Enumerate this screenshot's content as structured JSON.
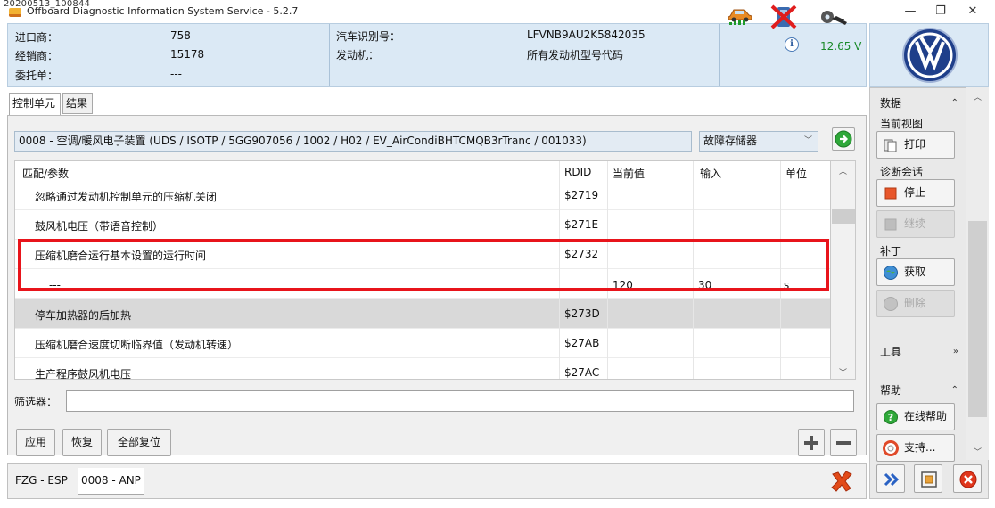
{
  "titlebar": {
    "stamp": "20200513_100844",
    "title": "Offboard Diagnostic Information System Service - 5.2.7",
    "minimize": "—",
    "restore": "❐",
    "close": "✕"
  },
  "header": {
    "importer_label": "进口商：",
    "importer_value": "758",
    "dealer_label": "经销商：",
    "dealer_value": "15178",
    "order_label": "委托单：",
    "order_value": "---",
    "vin_label": "汽车识别号：",
    "vin_value": "LFVNB9AU2K5842035",
    "engine_label": "发动机：",
    "engine_value": "所有发动机型号代码",
    "voltage": "12.65 V"
  },
  "tabs": [
    {
      "label": "控制单元"
    },
    {
      "label": "结果"
    }
  ],
  "control_unit": {
    "description": "0008 - 空调/暖风电子装置 (UDS / ISOTP / 5GG907056 / 1002 / H02 / EV_AirCondiBHTCMQB3rTranc / 001033)",
    "mode": "故障存储器"
  },
  "table": {
    "columns": {
      "param": "匹配/参数",
      "rdid": "RDID",
      "current": "当前值",
      "input": "输入",
      "unit": "单位"
    },
    "rows": [
      {
        "param": "忽略通过发动机控制单元的压缩机关闭",
        "rdid": "$2719",
        "current": "",
        "input": "",
        "unit": ""
      },
      {
        "param": "鼓风机电压（带语音控制）",
        "rdid": "$271E",
        "current": "",
        "input": "",
        "unit": ""
      },
      {
        "param": "压缩机磨合运行基本设置的运行时间",
        "rdid": "$2732",
        "current": "",
        "input": "",
        "unit": ""
      },
      {
        "param": "---",
        "rdid": "",
        "current": "120",
        "input": "30",
        "unit": "s"
      },
      {
        "param": "停车加热器的后加热",
        "rdid": "$273D",
        "current": "",
        "input": "",
        "unit": ""
      },
      {
        "param": "压缩机磨合速度切断临界值（发动机转速）",
        "rdid": "$27AB",
        "current": "",
        "input": "",
        "unit": ""
      },
      {
        "param": "生产程序鼓风机电压",
        "rdid": "$27AC",
        "current": "",
        "input": "",
        "unit": ""
      }
    ]
  },
  "filter": {
    "label": "筛选器：",
    "value": ""
  },
  "buttons": {
    "apply": "应用",
    "restore": "恢复",
    "reset_all": "全部复位"
  },
  "status_tabs": [
    {
      "label": "FZG - ESP"
    },
    {
      "label": "0008 - ANP"
    }
  ],
  "sidebar": {
    "data_group": "数据",
    "current_view": "当前视图",
    "print": "打印",
    "diag_session": "诊断会话",
    "stop": "停止",
    "continue": "继续",
    "patch": "补丁",
    "fetch": "获取",
    "delete": "删除",
    "tools_group": "工具",
    "help_group": "帮助",
    "online_help": "在线帮助",
    "support": "支持..."
  },
  "colors": {
    "header_bg": "#dbe9f5",
    "highlight": "#e8141b",
    "voltage": "#1b8a2a",
    "selected_row": "#d9d9d9"
  }
}
